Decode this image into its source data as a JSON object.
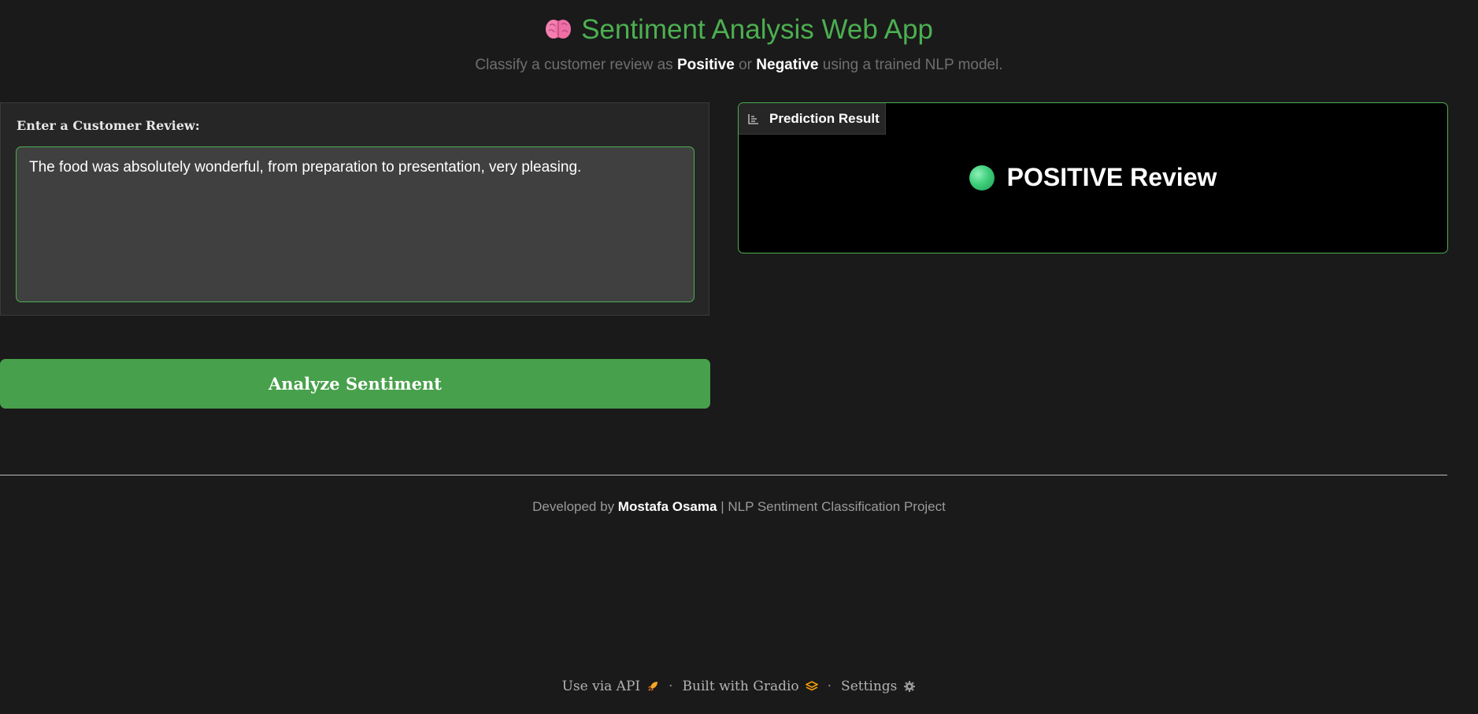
{
  "header": {
    "title": "Sentiment Analysis Web App",
    "title_icon": "brain-icon",
    "subtitle_prefix": "Classify a customer review as ",
    "subtitle_positive": "Positive",
    "subtitle_or": " or ",
    "subtitle_negative": "Negative",
    "subtitle_suffix": " using a trained NLP model."
  },
  "input": {
    "label": "Enter a Customer Review:",
    "value": "The food was absolutely wonderful, from preparation to presentation, very pleasing."
  },
  "button": {
    "label": "Analyze Sentiment"
  },
  "result": {
    "tab_label": "Prediction Result",
    "tab_icon": "bar-chart-icon",
    "text": "POSITIVE Review",
    "indicator_color": "#3ecf7a"
  },
  "credit": {
    "prefix": "Developed by ",
    "author": "Mostafa Osama",
    "suffix": " | NLP Sentiment Classification Project"
  },
  "footer": {
    "api_label": "Use via API",
    "api_icon": "rocket-icon",
    "separator": "·",
    "gradio_label": "Built with Gradio",
    "gradio_icon": "gradio-logo-icon",
    "settings_label": "Settings",
    "settings_icon": "gear-icon"
  },
  "colors": {
    "accent": "#4caf50",
    "background": "#1a1a1a",
    "button": "#47a04b"
  }
}
